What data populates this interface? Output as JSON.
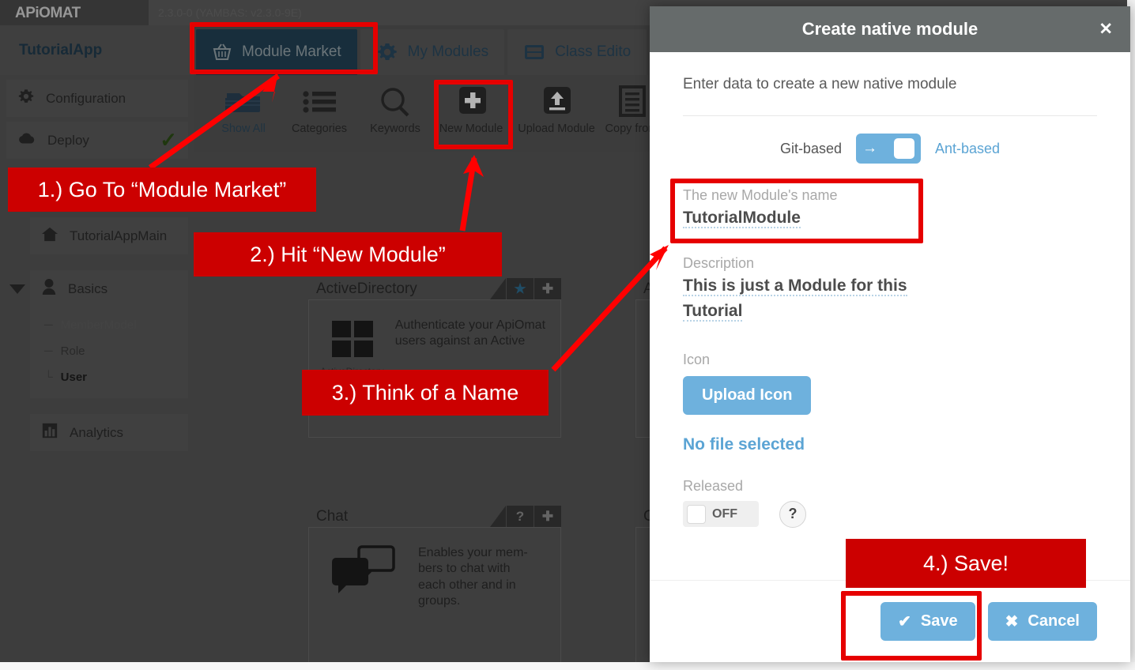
{
  "brand": {
    "logo_text": "APiOMAT",
    "version": "2.3.0-0 (YAMBAS: v2.3.0-9E)"
  },
  "app": {
    "name": "TutorialApp"
  },
  "tabs": [
    {
      "label": "Module Market",
      "icon": "basket-icon",
      "active": true
    },
    {
      "label": "My Modules",
      "icon": "gear-icon",
      "active": false
    },
    {
      "label": "Class Edito",
      "icon": "class-editor-icon",
      "active": false
    }
  ],
  "toolbar": [
    {
      "label": "Show All",
      "icon": "stack-icon"
    },
    {
      "label": "Categories",
      "icon": "list-icon"
    },
    {
      "label": "Keywords",
      "icon": "search-icon"
    },
    {
      "label": "New Module",
      "icon": "plus-square-icon"
    },
    {
      "label": "Upload Module",
      "icon": "upload-square-icon"
    },
    {
      "label": "Copy from",
      "icon": "document-icon"
    }
  ],
  "sidebar": {
    "top_items": [
      {
        "label": "Configuration",
        "icon": "gear-icon",
        "check": ""
      },
      {
        "label": "Deploy",
        "icon": "cloud-icon",
        "check": "✓"
      }
    ],
    "main_item": {
      "label": "TutorialAppMain",
      "icon": "home-icon"
    },
    "group": {
      "label": "Basics",
      "icon": "user-icon",
      "children": [
        {
          "label": "MemberModel",
          "style": "muted"
        },
        {
          "label": "Role",
          "style": "normal"
        },
        {
          "label": "User",
          "style": "bold"
        }
      ]
    },
    "analytics": {
      "label": "Analytics",
      "icon": "chart-icon"
    }
  },
  "cards": [
    {
      "title": "ActiveDirectory",
      "badges": [
        "★",
        "✚"
      ],
      "icon_name": "windows-icon",
      "icon_caption": "ActiveDirectory",
      "description": "Authenticate your ApiOmat users against an Active"
    },
    {
      "title": "Chat",
      "badges": [
        "?",
        "✚"
      ],
      "icon_name": "chat-bubble-icon",
      "icon_caption": "",
      "description": "Enables your mem-bers to chat with each other and in groups."
    }
  ],
  "dialog": {
    "title": "Create native module",
    "close_label": "✕",
    "intro": "Enter data to create a new native module",
    "switch": {
      "left_label": "Git-based",
      "right_label": "Ant-based",
      "arrow": "→"
    },
    "name_field": {
      "label": "The new Module's name",
      "value": "TutorialModule"
    },
    "description_field": {
      "label": "Description",
      "value": "This is just a Module for this Tutorial"
    },
    "icon_field": {
      "label": "Icon",
      "upload_button": "Upload Icon",
      "file_status": "No file selected"
    },
    "released_field": {
      "label": "Released",
      "toggle_state": "OFF",
      "help": "?"
    },
    "footer": {
      "save_label": "Save",
      "save_icon": "✔",
      "cancel_label": "Cancel",
      "cancel_icon": "✖"
    }
  },
  "annotations": [
    {
      "id": "step1",
      "text": "1.) Go To “Module Market”"
    },
    {
      "id": "step2",
      "text": "2.) Hit “New Module”"
    },
    {
      "id": "step3",
      "text": "3.) Think of a Name"
    },
    {
      "id": "step4",
      "text": "4.) Save!"
    }
  ],
  "colors": {
    "annotation_red": "#cc0000",
    "highlight_red": "#e60000",
    "accent_blue": "#6eb1dd",
    "dialog_header": "#666b6b"
  }
}
